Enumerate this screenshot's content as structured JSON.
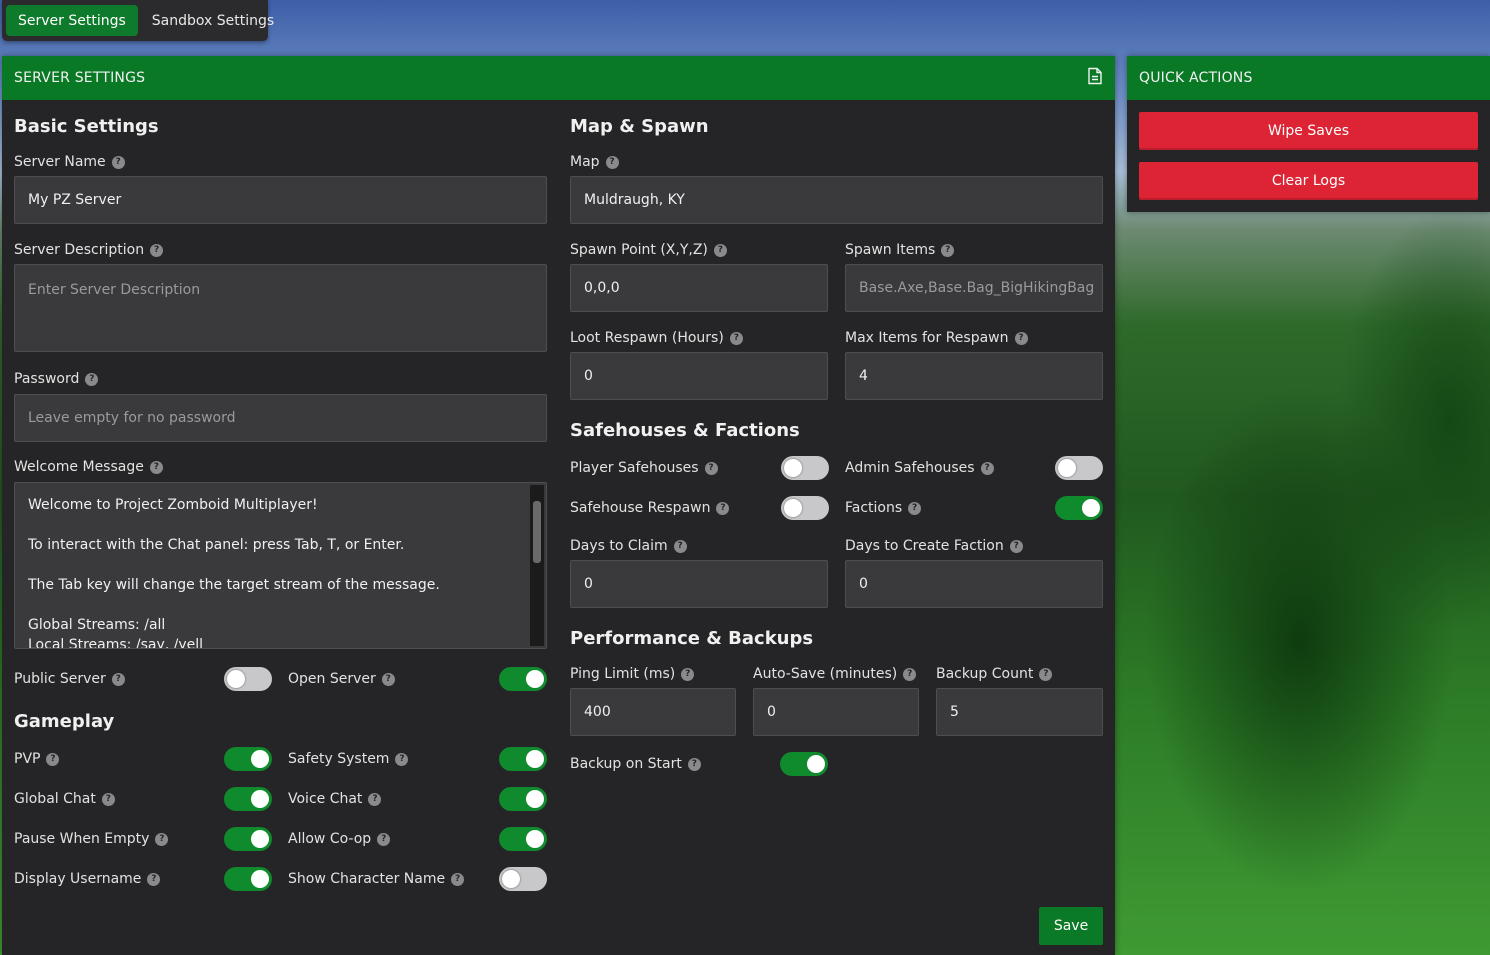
{
  "tabs": {
    "server": "Server Settings",
    "sandbox": "Sandbox Settings"
  },
  "main": {
    "header": "SERVER SETTINGS",
    "header_icon": "file-icon",
    "save": "Save"
  },
  "basic": {
    "title": "Basic Settings",
    "server_name_label": "Server Name",
    "server_name_value": "My PZ Server",
    "server_desc_label": "Server Description",
    "server_desc_placeholder": "Enter Server Description",
    "password_label": "Password",
    "password_placeholder": "Leave empty for no password",
    "welcome_label": "Welcome Message",
    "welcome_lines": [
      "Welcome to Project Zomboid Multiplayer!",
      "To interact with the Chat panel: press Tab, T, or Enter.",
      "The Tab key will change the target stream of the message.",
      "Global Streams: /all",
      "Local Streams: /say, /yell"
    ],
    "public_server_label": "Public Server",
    "public_server_on": false,
    "open_server_label": "Open Server",
    "open_server_on": true
  },
  "gameplay": {
    "title": "Gameplay",
    "pvp_label": "PVP",
    "pvp_on": true,
    "safety_label": "Safety System",
    "safety_on": true,
    "global_chat_label": "Global Chat",
    "global_chat_on": true,
    "voice_chat_label": "Voice Chat",
    "voice_chat_on": true,
    "pause_label": "Pause When Empty",
    "pause_on": true,
    "coop_label": "Allow Co-op",
    "coop_on": true,
    "display_user_label": "Display Username",
    "display_user_on": true,
    "show_char_label": "Show Character Name",
    "show_char_on": false
  },
  "map_spawn": {
    "title": "Map & Spawn",
    "map_label": "Map",
    "map_value": "Muldraugh, KY",
    "spawn_point_label": "Spawn Point (X,Y,Z)",
    "spawn_point_value": "0,0,0",
    "spawn_items_label": "Spawn Items",
    "spawn_items_placeholder": "Base.Axe,Base.Bag_BigHikingBag",
    "loot_respawn_label": "Loot Respawn (Hours)",
    "loot_respawn_value": "0",
    "max_items_label": "Max Items for Respawn",
    "max_items_value": "4"
  },
  "safehouses": {
    "title": "Safehouses & Factions",
    "player_safe_label": "Player Safehouses",
    "player_safe_on": false,
    "admin_safe_label": "Admin Safehouses",
    "admin_safe_on": false,
    "safe_respawn_label": "Safehouse Respawn",
    "safe_respawn_on": false,
    "factions_label": "Factions",
    "factions_on": true,
    "days_claim_label": "Days to Claim",
    "days_claim_value": "0",
    "days_faction_label": "Days to Create Faction",
    "days_faction_value": "0"
  },
  "performance": {
    "title": "Performance & Backups",
    "ping_label": "Ping Limit (ms)",
    "ping_value": "400",
    "autosave_label": "Auto-Save (minutes)",
    "autosave_value": "0",
    "backup_count_label": "Backup Count",
    "backup_count_value": "5",
    "backup_start_label": "Backup on Start",
    "backup_start_on": true
  },
  "quick": {
    "header": "QUICK ACTIONS",
    "wipe": "Wipe Saves",
    "clear": "Clear Logs"
  },
  "colors": {
    "accent_green": "#097925",
    "danger_red": "#dc2434",
    "panel_bg": "#252527",
    "input_bg": "#3a3a3c"
  }
}
